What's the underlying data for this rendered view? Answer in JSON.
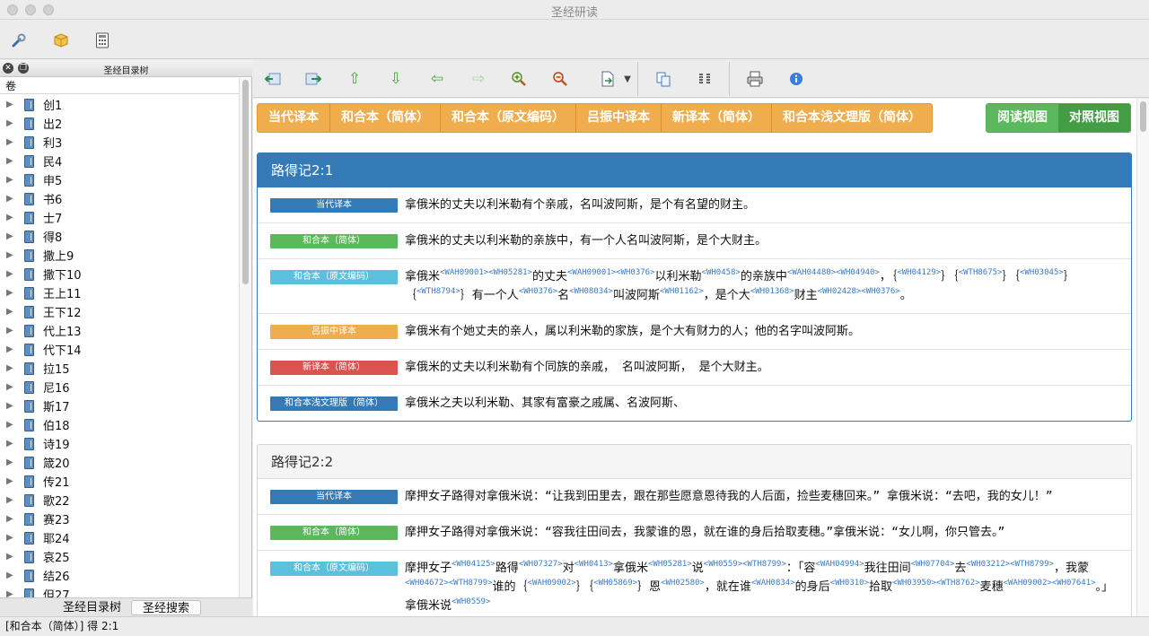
{
  "window": {
    "title": "圣经研读"
  },
  "left_panel": {
    "title": "圣经目录树",
    "column_header": "卷",
    "books": [
      "创1",
      "出2",
      "利3",
      "民4",
      "申5",
      "书6",
      "士7",
      "得8",
      "撒上9",
      "撒下10",
      "王上11",
      "王下12",
      "代上13",
      "代下14",
      "拉15",
      "尼16",
      "斯17",
      "伯18",
      "诗19",
      "箴20",
      "传21",
      "歌22",
      "赛23",
      "耶24",
      "哀25",
      "结26",
      "但27"
    ],
    "tabs": [
      "圣经目录树",
      "圣经搜索"
    ]
  },
  "translation_tabs": [
    "当代译本",
    "和合本（简体）",
    "和合本（原文编码）",
    "吕振中译本",
    "新译本（简体）",
    "和合本浅文理版（简体）"
  ],
  "view_buttons": [
    "阅读视图",
    "对照视图"
  ],
  "verse1": {
    "ref": "路得记2:1",
    "rows": [
      {
        "label": "当代译本",
        "text": "拿俄米的丈夫以利米勒有个亲戚，名叫波阿斯，是个有名望的财主。"
      },
      {
        "label": "和合本（简体）",
        "text": "拿俄米的丈夫以利米勒的亲族中，有一个人名叫波阿斯，是个大财主。"
      },
      {
        "label": "和合本（原文编码）"
      },
      {
        "label": "吕振中译本",
        "text": "拿俄米有个她丈夫的亲人，属以利米勒的家族，是个大有财力的人；他的名字叫波阿斯。"
      },
      {
        "label": "新译本（简体）",
        "text": "拿俄米的丈夫以利米勒有个同族的亲戚， 名叫波阿斯， 是个大财主。"
      },
      {
        "label": "和合本浅文理版（简体）",
        "text": "拿俄米之夫以利米勒、其家有富豪之戚属、名波阿斯、"
      }
    ],
    "coded": [
      {
        "t": "拿俄米"
      },
      {
        "s": "<WAH09001><WH05281>"
      },
      {
        "t": "的丈夫"
      },
      {
        "s": "<WAH09001><WH0376>"
      },
      {
        "t": "以利米勒"
      },
      {
        "s": "<WH0458>"
      },
      {
        "t": "的亲族中"
      },
      {
        "s": "<WAH04480><WH04940>"
      },
      {
        "t": "，｛"
      },
      {
        "s": "<WH04129>"
      },
      {
        "t": "｝｛"
      },
      {
        "s": "<WTH8675>"
      },
      {
        "t": "｝｛"
      },
      {
        "s": "<WH03045>"
      },
      {
        "t": "｝｛"
      },
      {
        "s": "<WTH8794>"
      },
      {
        "t": "｝有一个人"
      },
      {
        "s": "<WH0376>"
      },
      {
        "t": "名"
      },
      {
        "s": "<WH08034>"
      },
      {
        "t": "叫波阿斯"
      },
      {
        "s": "<WH01162>"
      },
      {
        "t": "，是个大"
      },
      {
        "s": "<WH01368>"
      },
      {
        "t": "财主"
      },
      {
        "s": "<WH02428><WH0376>"
      },
      {
        "t": "。"
      }
    ]
  },
  "verse2": {
    "ref": "路得记2:2",
    "rows": [
      {
        "label": "当代译本",
        "text": "摩押女子路得对拿俄米说：“让我到田里去，跟在那些愿意恩待我的人后面，捡些麦穗回来。” 拿俄米说：“去吧，我的女儿！”"
      },
      {
        "label": "和合本（简体）",
        "text": "摩押女子路得对拿俄米说：“容我往田间去，我蒙谁的恩，就在谁的身后拾取麦穗。”拿俄米说：“女儿啊，你只管去。”"
      },
      {
        "label": "和合本（原文编码）"
      }
    ],
    "coded": [
      {
        "t": "摩押女子"
      },
      {
        "s": "<WH04125>"
      },
      {
        "t": "路得"
      },
      {
        "s": "<WH07327>"
      },
      {
        "t": "对"
      },
      {
        "s": "<WH0413>"
      },
      {
        "t": "拿俄米"
      },
      {
        "s": "<WH05281>"
      },
      {
        "t": "说"
      },
      {
        "s": "<WH0559><WTH8799>"
      },
      {
        "t": "：「容"
      },
      {
        "s": "<WAH04994>"
      },
      {
        "t": "我往田间"
      },
      {
        "s": "<WH07704>"
      },
      {
        "t": "去"
      },
      {
        "s": "<WH03212><WTH8799>"
      },
      {
        "t": "，我蒙"
      },
      {
        "s": "<WH04672><WTH8799>"
      },
      {
        "t": "谁的｛"
      },
      {
        "s": "<WAH09002>"
      },
      {
        "t": "｝｛"
      },
      {
        "s": "<WH05869>"
      },
      {
        "t": "｝恩"
      },
      {
        "s": "<WH02580>"
      },
      {
        "t": "，就在谁"
      },
      {
        "s": "<WAH0834>"
      },
      {
        "t": "的身后"
      },
      {
        "s": "<WH0310>"
      },
      {
        "t": "拾取"
      },
      {
        "s": "<WH03950><WTH8762>"
      },
      {
        "t": "麦穗"
      },
      {
        "s": "<WAH09002><WH07641>"
      },
      {
        "t": "。」拿俄米说"
      },
      {
        "s": "<WH0559>"
      }
    ]
  },
  "status_bar": {
    "text": "[和合本（简体）] 得 2:1"
  },
  "colors": {
    "primary": "#337ab7",
    "success": "#5cb85c",
    "info": "#5bc0de",
    "warning": "#f0ad4e",
    "danger": "#d9534f"
  }
}
